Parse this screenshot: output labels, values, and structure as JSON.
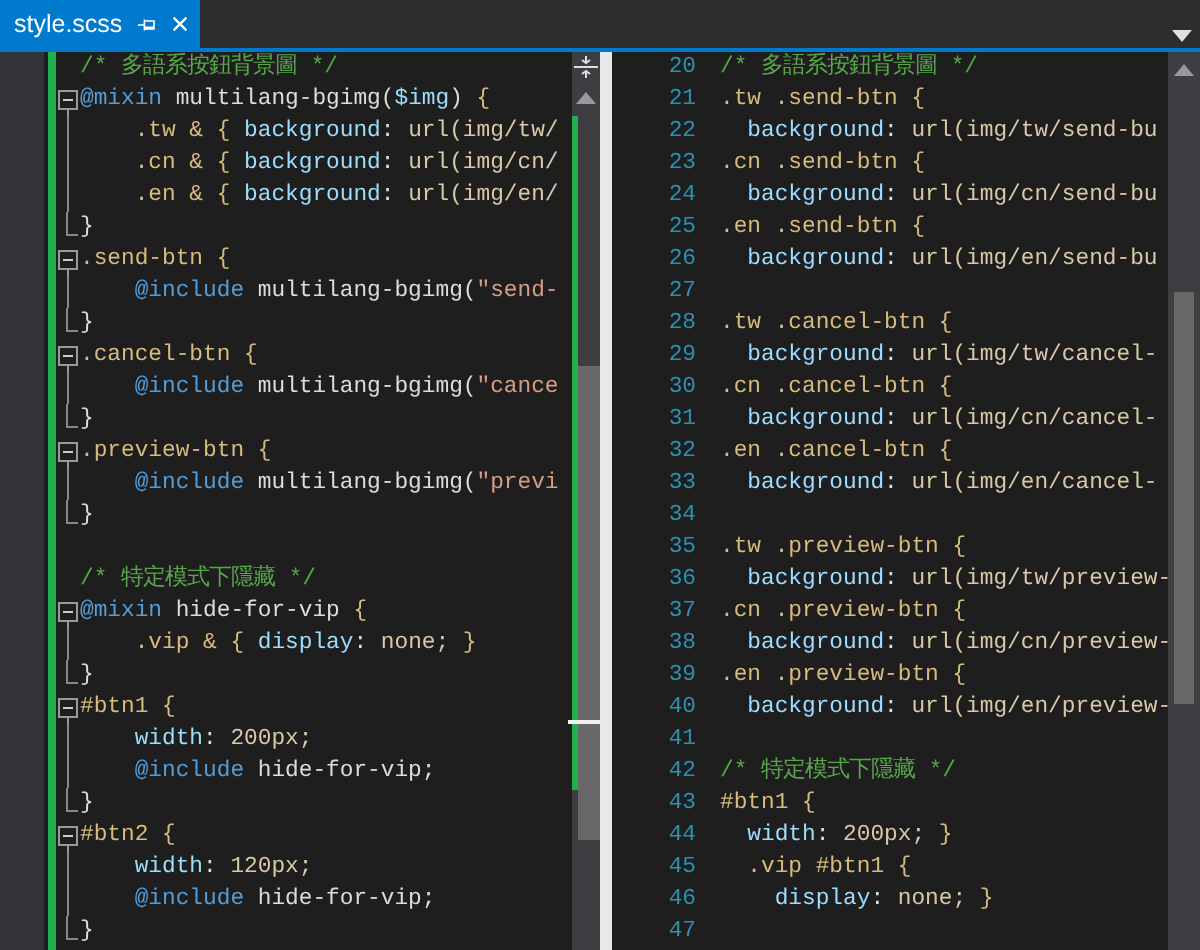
{
  "tab": {
    "title": "style.scss",
    "selected": true
  },
  "left_pane": {
    "lines": [
      {
        "kind": "plain",
        "tokens": [
          {
            "kind": "comment",
            "text": "/* 多語系按鈕背景圖 */"
          }
        ]
      },
      {
        "kind": "start",
        "tokens": [
          {
            "kind": "at",
            "text": "@mixin"
          },
          {
            "kind": "plain",
            "text": " multilang-bgimg("
          },
          {
            "kind": "var",
            "text": "$img"
          },
          {
            "kind": "plain",
            "text": ") "
          },
          {
            "kind": "sel",
            "text": "{"
          }
        ]
      },
      {
        "kind": "inner",
        "tokens": [
          {
            "kind": "sel",
            "text": "    .tw & { "
          },
          {
            "kind": "prop",
            "text": "background"
          },
          {
            "kind": "plain",
            "text": ": "
          },
          {
            "kind": "val",
            "text": "url(img/tw/"
          }
        ]
      },
      {
        "kind": "inner",
        "tokens": [
          {
            "kind": "sel",
            "text": "    .cn & { "
          },
          {
            "kind": "prop",
            "text": "background"
          },
          {
            "kind": "plain",
            "text": ": "
          },
          {
            "kind": "val",
            "text": "url(img/cn/"
          }
        ]
      },
      {
        "kind": "inner",
        "tokens": [
          {
            "kind": "sel",
            "text": "    .en & { "
          },
          {
            "kind": "prop",
            "text": "background"
          },
          {
            "kind": "plain",
            "text": ": "
          },
          {
            "kind": "val",
            "text": "url(img/en/"
          }
        ]
      },
      {
        "kind": "end",
        "tokens": [
          {
            "kind": "plain",
            "text": "}"
          }
        ]
      },
      {
        "kind": "start",
        "tokens": [
          {
            "kind": "sel",
            "text": ".send-btn {"
          }
        ]
      },
      {
        "kind": "inner",
        "tokens": [
          {
            "kind": "at",
            "text": "    @include"
          },
          {
            "kind": "plain",
            "text": " multilang-bgimg("
          },
          {
            "kind": "str",
            "text": "\"send-"
          }
        ]
      },
      {
        "kind": "end",
        "tokens": [
          {
            "kind": "plain",
            "text": "}"
          }
        ]
      },
      {
        "kind": "start",
        "tokens": [
          {
            "kind": "sel",
            "text": ".cancel-btn {"
          }
        ]
      },
      {
        "kind": "inner",
        "tokens": [
          {
            "kind": "at",
            "text": "    @include"
          },
          {
            "kind": "plain",
            "text": " multilang-bgimg("
          },
          {
            "kind": "str",
            "text": "\"cance"
          }
        ]
      },
      {
        "kind": "end",
        "tokens": [
          {
            "kind": "plain",
            "text": "}"
          }
        ]
      },
      {
        "kind": "start",
        "tokens": [
          {
            "kind": "sel",
            "text": ".preview-btn {"
          }
        ]
      },
      {
        "kind": "inner",
        "tokens": [
          {
            "kind": "at",
            "text": "    @include"
          },
          {
            "kind": "plain",
            "text": " multilang-bgimg("
          },
          {
            "kind": "str",
            "text": "\"previ"
          }
        ]
      },
      {
        "kind": "end",
        "tokens": [
          {
            "kind": "plain",
            "text": "}"
          }
        ]
      },
      {
        "kind": "plain"
      },
      {
        "kind": "plain",
        "tokens": [
          {
            "kind": "comment",
            "text": "/* 特定模式下隱藏 */"
          }
        ]
      },
      {
        "kind": "start",
        "tokens": [
          {
            "kind": "at",
            "text": "@mixin"
          },
          {
            "kind": "plain",
            "text": " hide-for-vip "
          },
          {
            "kind": "sel",
            "text": "{"
          }
        ]
      },
      {
        "kind": "inner",
        "tokens": [
          {
            "kind": "sel",
            "text": "    .vip & { "
          },
          {
            "kind": "prop",
            "text": "display"
          },
          {
            "kind": "plain",
            "text": ": "
          },
          {
            "kind": "val",
            "text": "none; "
          },
          {
            "kind": "sel",
            "text": "}"
          }
        ]
      },
      {
        "kind": "end",
        "tokens": [
          {
            "kind": "plain",
            "text": "}"
          }
        ]
      },
      {
        "kind": "start",
        "tokens": [
          {
            "kind": "sel",
            "text": "#btn1 {"
          }
        ]
      },
      {
        "kind": "inner",
        "tokens": [
          {
            "kind": "prop",
            "text": "    width"
          },
          {
            "kind": "plain",
            "text": ": "
          },
          {
            "kind": "val",
            "text": "200px;"
          }
        ]
      },
      {
        "kind": "inner",
        "tokens": [
          {
            "kind": "at",
            "text": "    @include"
          },
          {
            "kind": "plain",
            "text": " hide-for-vip;"
          }
        ]
      },
      {
        "kind": "end",
        "tokens": [
          {
            "kind": "plain",
            "text": "}"
          }
        ]
      },
      {
        "kind": "start",
        "tokens": [
          {
            "kind": "sel",
            "text": "#btn2 {"
          }
        ]
      },
      {
        "kind": "inner",
        "tokens": [
          {
            "kind": "prop",
            "text": "    width"
          },
          {
            "kind": "plain",
            "text": ": "
          },
          {
            "kind": "val",
            "text": "120px;"
          }
        ]
      },
      {
        "kind": "inner",
        "tokens": [
          {
            "kind": "at",
            "text": "    @include"
          },
          {
            "kind": "plain",
            "text": " hide-for-vip;"
          }
        ]
      },
      {
        "kind": "end",
        "tokens": [
          {
            "kind": "plain",
            "text": "}"
          }
        ]
      }
    ]
  },
  "right_pane": {
    "lines": [
      {
        "number": "20",
        "tokens": [
          {
            "kind": "comment",
            "text": "/* 多語系按鈕背景圖 */"
          }
        ]
      },
      {
        "number": "21",
        "tokens": [
          {
            "kind": "sel",
            "text": ".tw .send-btn {"
          }
        ]
      },
      {
        "number": "22",
        "tokens": [
          {
            "kind": "prop",
            "text": "  background"
          },
          {
            "kind": "plain",
            "text": ": "
          },
          {
            "kind": "val",
            "text": "url(img/tw/send-bu"
          }
        ]
      },
      {
        "number": "23",
        "tokens": [
          {
            "kind": "sel",
            "text": ".cn .send-btn {"
          }
        ]
      },
      {
        "number": "24",
        "tokens": [
          {
            "kind": "prop",
            "text": "  background"
          },
          {
            "kind": "plain",
            "text": ": "
          },
          {
            "kind": "val",
            "text": "url(img/cn/send-bu"
          }
        ]
      },
      {
        "number": "25",
        "tokens": [
          {
            "kind": "sel",
            "text": ".en .send-btn {"
          }
        ]
      },
      {
        "number": "26",
        "tokens": [
          {
            "kind": "prop",
            "text": "  background"
          },
          {
            "kind": "plain",
            "text": ": "
          },
          {
            "kind": "val",
            "text": "url(img/en/send-bu"
          }
        ]
      },
      {
        "number": "27"
      },
      {
        "number": "28",
        "tokens": [
          {
            "kind": "sel",
            "text": ".tw .cancel-btn {"
          }
        ]
      },
      {
        "number": "29",
        "tokens": [
          {
            "kind": "prop",
            "text": "  background"
          },
          {
            "kind": "plain",
            "text": ": "
          },
          {
            "kind": "val",
            "text": "url(img/tw/cancel-"
          }
        ]
      },
      {
        "number": "30",
        "tokens": [
          {
            "kind": "sel",
            "text": ".cn .cancel-btn {"
          }
        ]
      },
      {
        "number": "31",
        "tokens": [
          {
            "kind": "prop",
            "text": "  background"
          },
          {
            "kind": "plain",
            "text": ": "
          },
          {
            "kind": "val",
            "text": "url(img/cn/cancel-"
          }
        ]
      },
      {
        "number": "32",
        "tokens": [
          {
            "kind": "sel",
            "text": ".en .cancel-btn {"
          }
        ]
      },
      {
        "number": "33",
        "tokens": [
          {
            "kind": "prop",
            "text": "  background"
          },
          {
            "kind": "plain",
            "text": ": "
          },
          {
            "kind": "val",
            "text": "url(img/en/cancel-"
          }
        ]
      },
      {
        "number": "34"
      },
      {
        "number": "35",
        "tokens": [
          {
            "kind": "sel",
            "text": ".tw .preview-btn {"
          }
        ]
      },
      {
        "number": "36",
        "tokens": [
          {
            "kind": "prop",
            "text": "  background"
          },
          {
            "kind": "plain",
            "text": ": "
          },
          {
            "kind": "val",
            "text": "url(img/tw/preview-"
          }
        ]
      },
      {
        "number": "37",
        "tokens": [
          {
            "kind": "sel",
            "text": ".cn .preview-btn {"
          }
        ]
      },
      {
        "number": "38",
        "tokens": [
          {
            "kind": "prop",
            "text": "  background"
          },
          {
            "kind": "plain",
            "text": ": "
          },
          {
            "kind": "val",
            "text": "url(img/cn/preview-"
          }
        ]
      },
      {
        "number": "39",
        "tokens": [
          {
            "kind": "sel",
            "text": ".en .preview-btn {"
          }
        ]
      },
      {
        "number": "40",
        "tokens": [
          {
            "kind": "prop",
            "text": "  background"
          },
          {
            "kind": "plain",
            "text": ": "
          },
          {
            "kind": "val",
            "text": "url(img/en/preview-"
          }
        ]
      },
      {
        "number": "41"
      },
      {
        "number": "42",
        "tokens": [
          {
            "kind": "comment",
            "text": "/* 特定模式下隱藏 */"
          }
        ]
      },
      {
        "number": "43",
        "tokens": [
          {
            "kind": "sel",
            "text": "#btn1 {"
          }
        ]
      },
      {
        "number": "44",
        "tokens": [
          {
            "kind": "prop",
            "text": "  width"
          },
          {
            "kind": "plain",
            "text": ": "
          },
          {
            "kind": "val",
            "text": "200px; "
          },
          {
            "kind": "sel",
            "text": "}"
          }
        ]
      },
      {
        "number": "45",
        "tokens": [
          {
            "kind": "sel",
            "text": "  .vip #btn1 {"
          }
        ]
      },
      {
        "number": "46",
        "tokens": [
          {
            "kind": "prop",
            "text": "    display"
          },
          {
            "kind": "plain",
            "text": ": "
          },
          {
            "kind": "val",
            "text": "none; "
          },
          {
            "kind": "sel",
            "text": "}"
          }
        ]
      },
      {
        "number": "47"
      }
    ]
  }
}
